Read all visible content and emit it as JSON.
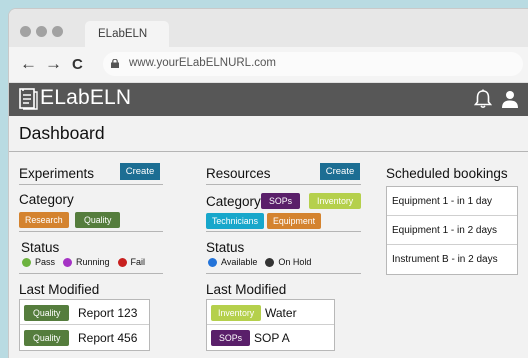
{
  "browser": {
    "tab_title": "ELabELN",
    "back_glyph": "←",
    "forward_glyph": "→",
    "reload_glyph": "C",
    "url": "www.yourELabELNURL.com"
  },
  "app": {
    "name": "ELabELN",
    "icons": {
      "logo": "document-icon",
      "notifications": "bell-icon",
      "profile": "user-icon"
    }
  },
  "page": {
    "title": "Dashboard"
  },
  "experiments": {
    "heading": "Experiments",
    "create_label": "Create",
    "category_heading": "Category",
    "categories": [
      {
        "label": "Research",
        "color": "#d4832f"
      },
      {
        "label": "Quality",
        "color": "#557d3d"
      }
    ],
    "status_heading": "Status",
    "statuses": [
      {
        "label": "Pass",
        "color": "#6db33f"
      },
      {
        "label": "Running",
        "color": "#a533c4"
      },
      {
        "label": "Fail",
        "color": "#c8201f"
      }
    ],
    "last_modified_heading": "Last Modified",
    "last_modified": [
      {
        "tag": "Quality",
        "name": "Report 123"
      },
      {
        "tag": "Quality",
        "name": "Report 456"
      }
    ]
  },
  "resources": {
    "heading": "Resources",
    "create_label": "Create",
    "category_heading": "Category",
    "categories": [
      {
        "label": "SOPs",
        "color": "#5a1f6a"
      },
      {
        "label": "Inventory",
        "color": "#b5d04c"
      },
      {
        "label": "Technicians",
        "color": "#18a7cb"
      },
      {
        "label": "Equipment",
        "color": "#d4832f"
      }
    ],
    "status_heading": "Status",
    "statuses": [
      {
        "label": "Available",
        "color": "#2474d9"
      },
      {
        "label": "On Hold",
        "color": "#333333"
      }
    ],
    "last_modified_heading": "Last Modified",
    "last_modified": [
      {
        "tag": "Inventory",
        "name": "Water"
      },
      {
        "tag": "SOPs",
        "name": "SOP A"
      }
    ]
  },
  "bookings": {
    "heading": "Scheduled bookings",
    "items": [
      "Equipment 1 - in 1 day",
      "Equipment 1 - in 2 days",
      "Instrument B - in 2 days"
    ]
  }
}
